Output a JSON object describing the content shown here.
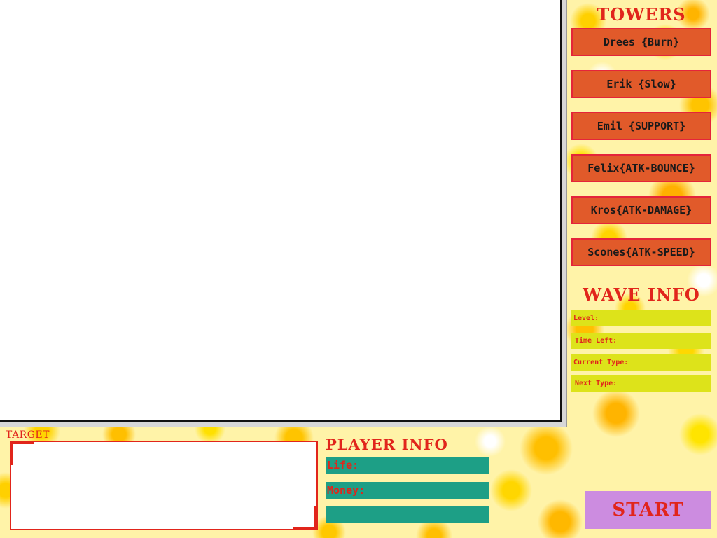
{
  "towers": {
    "heading": "TOWERS",
    "items": [
      {
        "label": "Drees {Burn}"
      },
      {
        "label": "Erik {Slow}"
      },
      {
        "label": "Emil {SUPPORT}"
      },
      {
        "label": "Felix{ATK-BOUNCE}"
      },
      {
        "label": "Kros{ATK-DAMAGE}"
      },
      {
        "label": "Scones{ATK-SPEED}"
      }
    ]
  },
  "wave_info": {
    "heading": "WAVE INFO",
    "level_label": "Level:",
    "time_left_label": "Time Left:",
    "current_type_label": "Current Type:",
    "next_type_label": "Next Type:"
  },
  "target": {
    "label": "TARGET"
  },
  "player_info": {
    "heading": "PLAYER INFO",
    "life_label": "Life:",
    "money_label": "Money:",
    "extra_value": ""
  },
  "start": {
    "label": "START"
  },
  "colors": {
    "accent_red": "#e1251b",
    "tower_button": "#e15a2a",
    "wave_row": "#dde31a",
    "player_row": "#1d9f86",
    "start_button": "#cc8ce0"
  }
}
